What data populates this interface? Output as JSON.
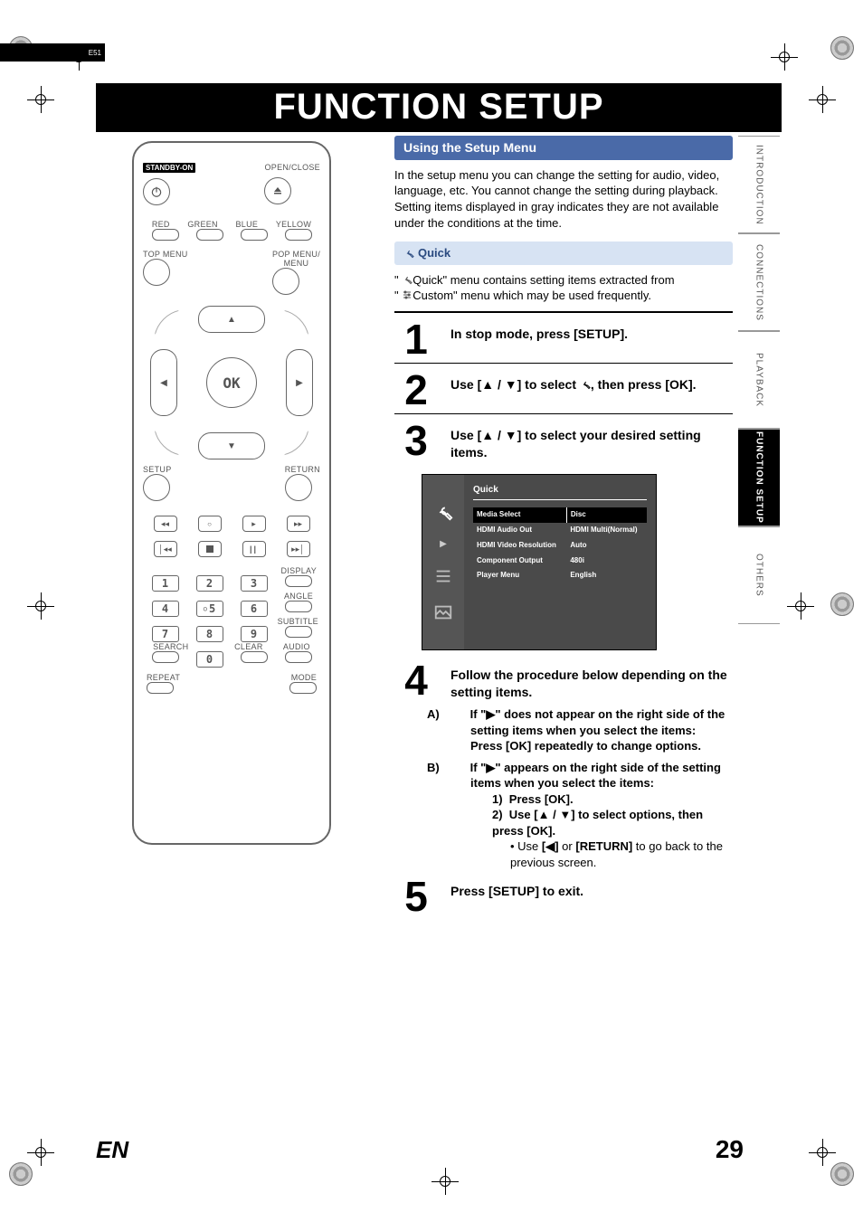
{
  "page": {
    "title": "FUNCTION SETUP",
    "cornerCode": "E51",
    "langCode": "EN",
    "pageNumber": "29"
  },
  "sideTabs": [
    {
      "label": "INTRODUCTION",
      "active": false
    },
    {
      "label": "CONNECTIONS",
      "active": false
    },
    {
      "label": "PLAYBACK",
      "active": false
    },
    {
      "label": "FUNCTION SETUP",
      "active": true
    },
    {
      "label": "OTHERS",
      "active": false
    }
  ],
  "remote": {
    "standbyLabel": "STANDBY-ON",
    "openClose": "OPEN/CLOSE",
    "colorLabels": [
      "RED",
      "GREEN",
      "BLUE",
      "YELLOW"
    ],
    "topMenu": "TOP MENU",
    "popMenu": "POP MENU/\nMENU",
    "ok": "OK",
    "setup": "SETUP",
    "return": "RETURN",
    "display": "DISPLAY",
    "angle": "ANGLE",
    "subtitle": "SUBTITLE",
    "search": "SEARCH",
    "clear": "CLEAR",
    "audio": "AUDIO",
    "repeat": "REPEAT",
    "mode": "MODE",
    "numbers": [
      "1",
      "2",
      "3",
      "4",
      "5",
      "6",
      "7",
      "8",
      "9",
      "0"
    ]
  },
  "sections": {
    "usingSetupTitle": "Using the Setup Menu",
    "usingSetupBody1": "In the setup menu you can change the setting for audio, video, language, etc. You cannot change the setting during playback.",
    "usingSetupBody2": "Setting items displayed in gray indicates they are not available under the conditions at the time.",
    "quickTitle": "Quick",
    "quickBody1": "Quick\" menu contains setting items extracted from",
    "quickBody2": "Custom\" menu which may be used frequently."
  },
  "steps": {
    "s1": "In stop mode, press [SETUP].",
    "s2a": "Use [",
    "s2b": " / ",
    "s2c": "] to select ",
    "s2d": ", then press [OK].",
    "s3a": "Use [",
    "s3b": " / ",
    "s3c": "] to select your desired setting items.",
    "s4": "Follow the procedure below depending on the setting items.",
    "s5": "Press [SETUP] to exit."
  },
  "menuShot": {
    "title": "Quick",
    "rows": [
      {
        "label": "Media Select",
        "value": "Disc",
        "selected": true
      },
      {
        "label": "HDMI Audio Out",
        "value": "HDMI Multi(Normal)",
        "selected": false
      },
      {
        "label": "HDMI Video Resolution",
        "value": "Auto",
        "selected": false
      },
      {
        "label": "Component Output",
        "value": "480i",
        "selected": false
      },
      {
        "label": "Player Menu",
        "value": "English",
        "selected": false
      }
    ]
  },
  "subSteps": {
    "A_header": "If \"",
    "A_header2": "\" does not appear on the right side of the setting items when you select the items:",
    "A_body": "Press [OK] repeatedly to change options.",
    "B_header": "If \"",
    "B_header2": "\" appears on the right side of the setting items when you select the items:",
    "B_1": "Press [OK].",
    "B_2a": "Use [",
    "B_2b": " / ",
    "B_2c": "] to select options, then press [OK].",
    "B_note_a": "Use ",
    "B_note_b": " or ",
    "B_note_c": "[RETURN]",
    "B_note_d": " to go back to the previous screen.",
    "labels": {
      "A": "A)",
      "B": "B)",
      "one": "1)",
      "two": "2)"
    }
  }
}
